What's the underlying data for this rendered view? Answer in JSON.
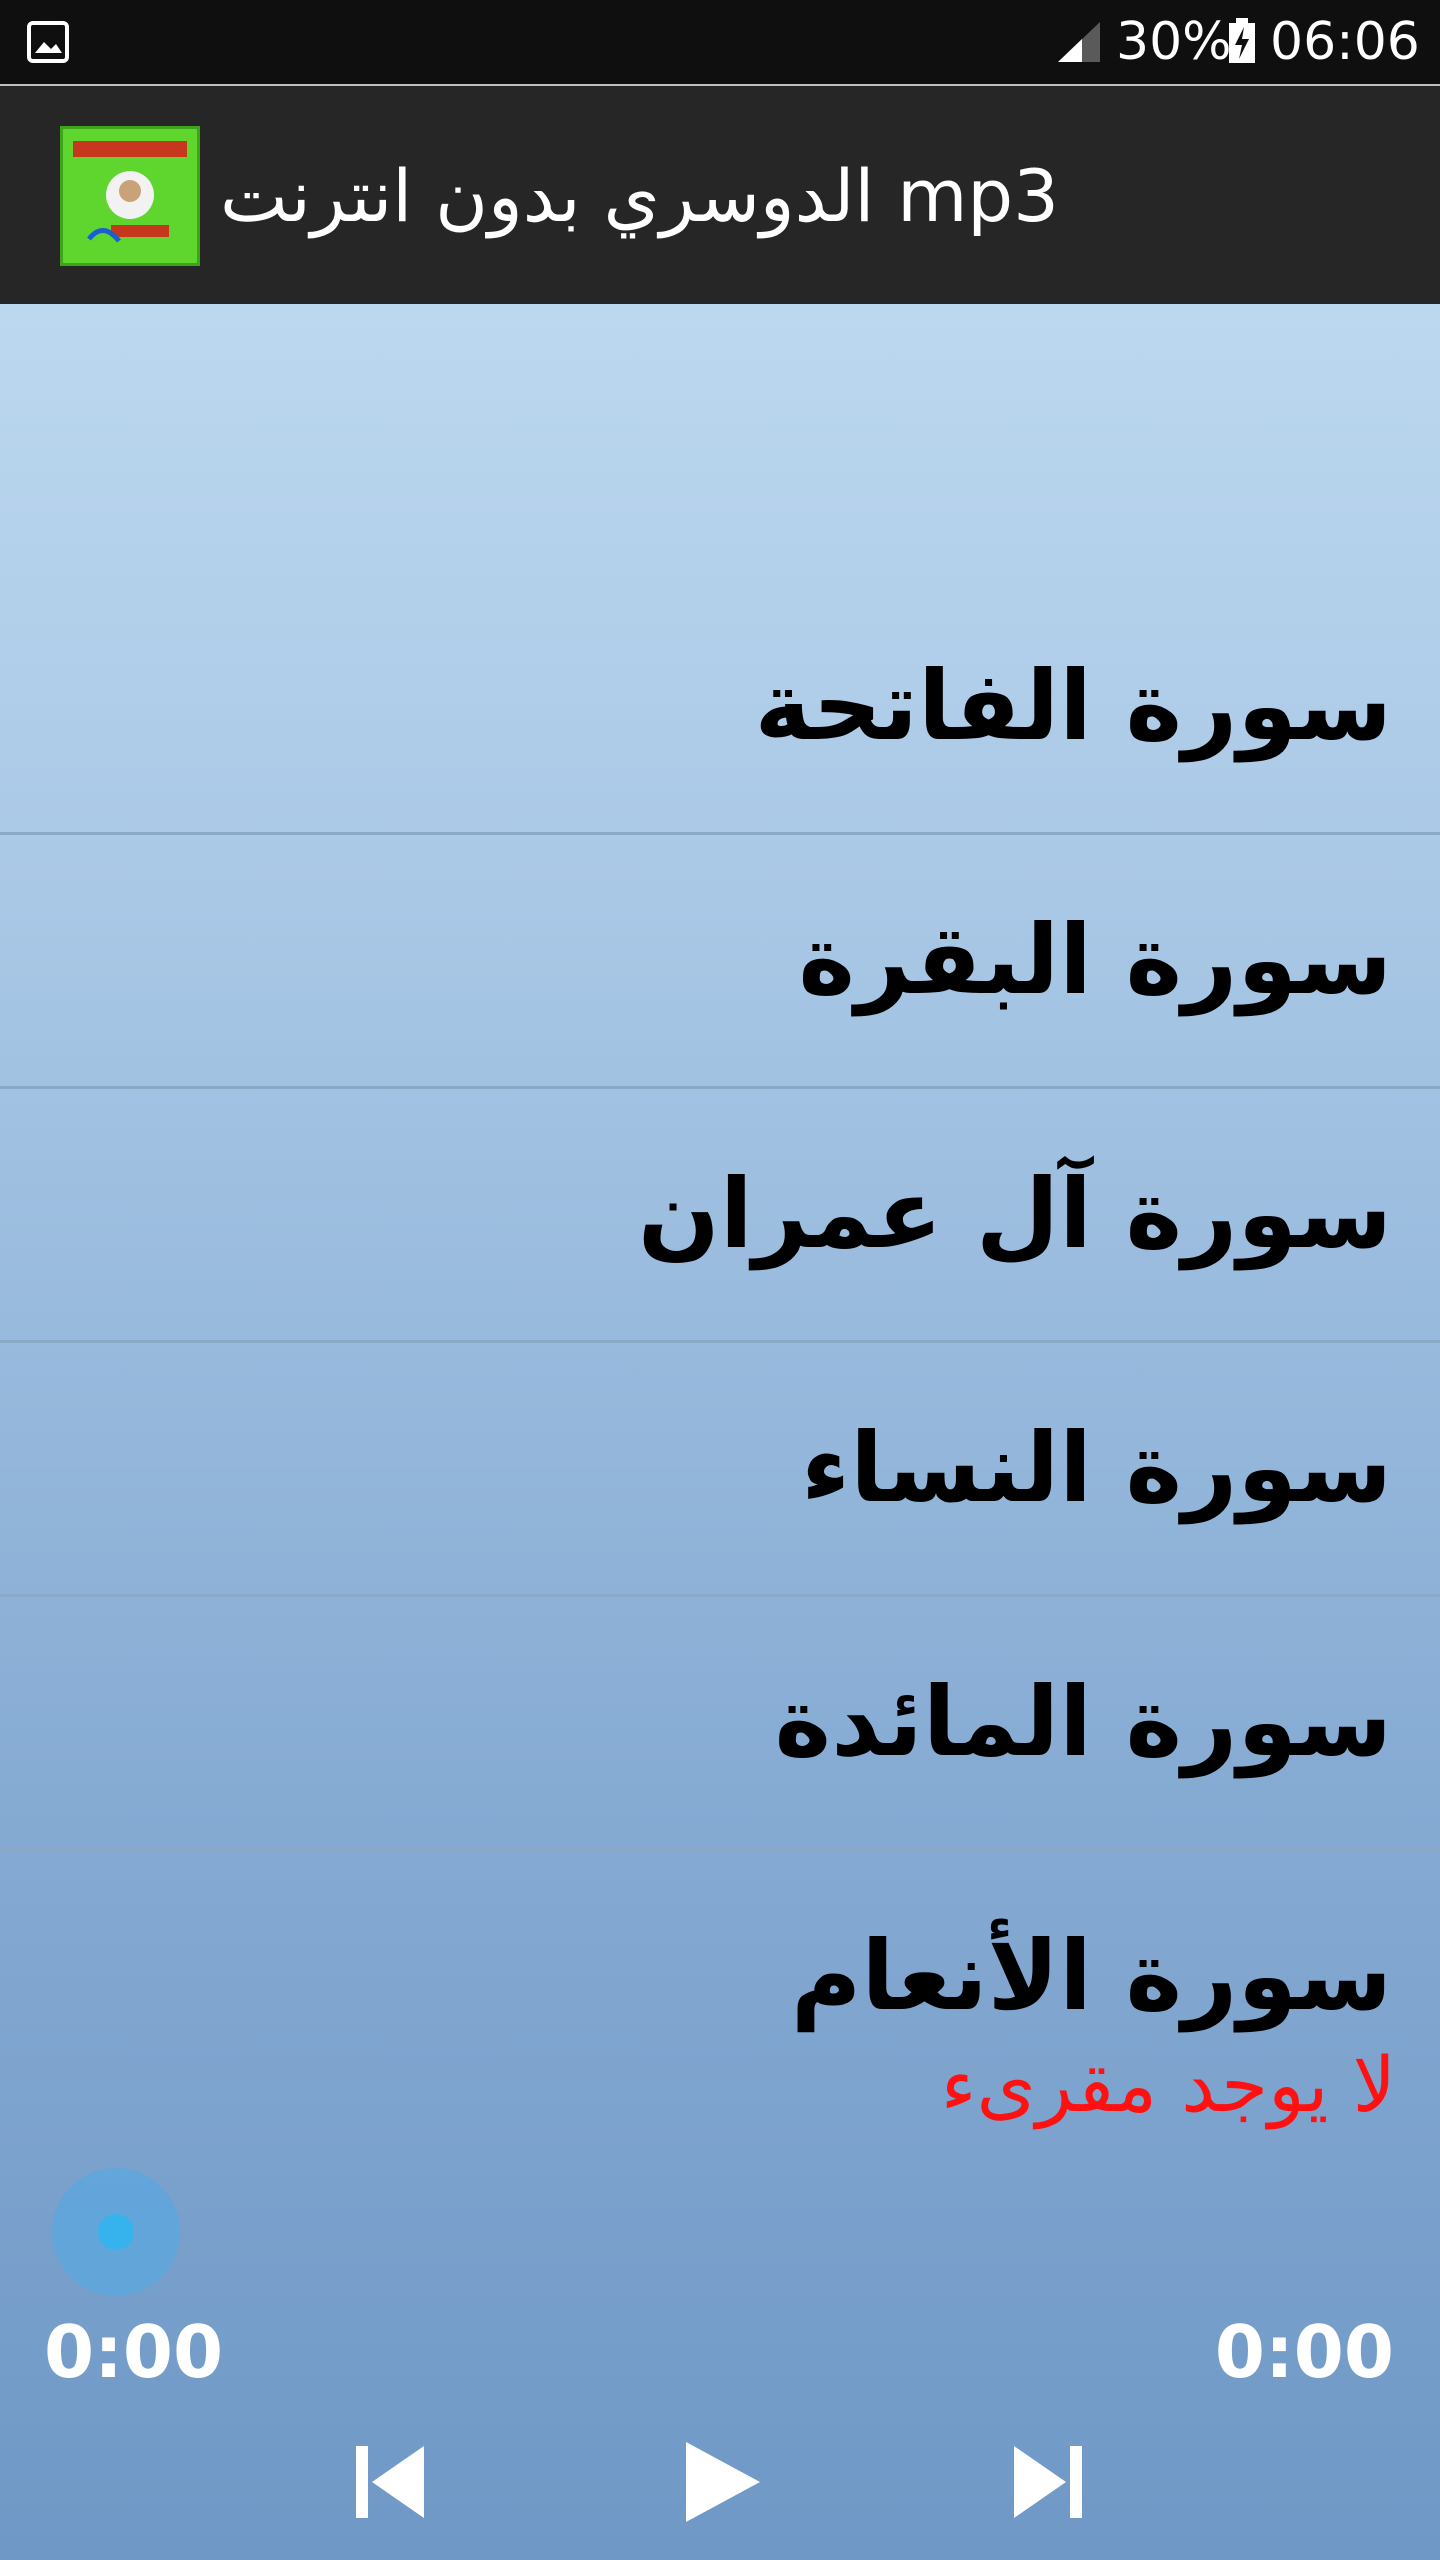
{
  "status_bar": {
    "battery_percent": "30%",
    "time": "06:06",
    "icons": [
      "gallery-icon",
      "signal-icon",
      "battery-charging-icon"
    ]
  },
  "app_bar": {
    "title": "الدوسري بدون انترنت mp3",
    "icon": "app-logo-icon",
    "accent": "#5ed62d"
  },
  "surahs": [
    "سورة الفاتحة",
    "سورة البقرة",
    "سورة آل عمران",
    "سورة النساء",
    "سورة المائدة",
    "سورة الأنعام"
  ],
  "player": {
    "status_text": "لا يوجد مقرىء",
    "status_color": "#ff1111",
    "elapsed": "0:00",
    "duration": "0:00",
    "progress": 0,
    "controls": [
      "previous-icon",
      "play-icon",
      "next-icon"
    ]
  }
}
